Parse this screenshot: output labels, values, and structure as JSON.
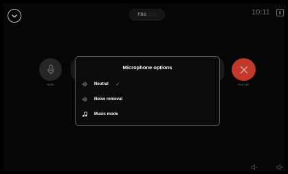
{
  "call": {
    "id": "FBS",
    "duration": "0:11",
    "clock": "10:11"
  },
  "controls": {
    "mute_label": "Mute",
    "end_call_label": "End call"
  },
  "microphone_modal": {
    "title": "Microphone options",
    "options": [
      {
        "label": "Neutral",
        "icon": "waveform-icon",
        "selected": true
      },
      {
        "label": "Noise removal",
        "icon": "waveform-icon",
        "selected": false
      },
      {
        "label": "Music mode",
        "icon": "music-note-icon",
        "selected": false
      }
    ],
    "check_mark": "✓"
  },
  "colors": {
    "end_call": "#c0392b",
    "selected_check": "#2ec27e",
    "modal_border": "#5a5a5a"
  }
}
